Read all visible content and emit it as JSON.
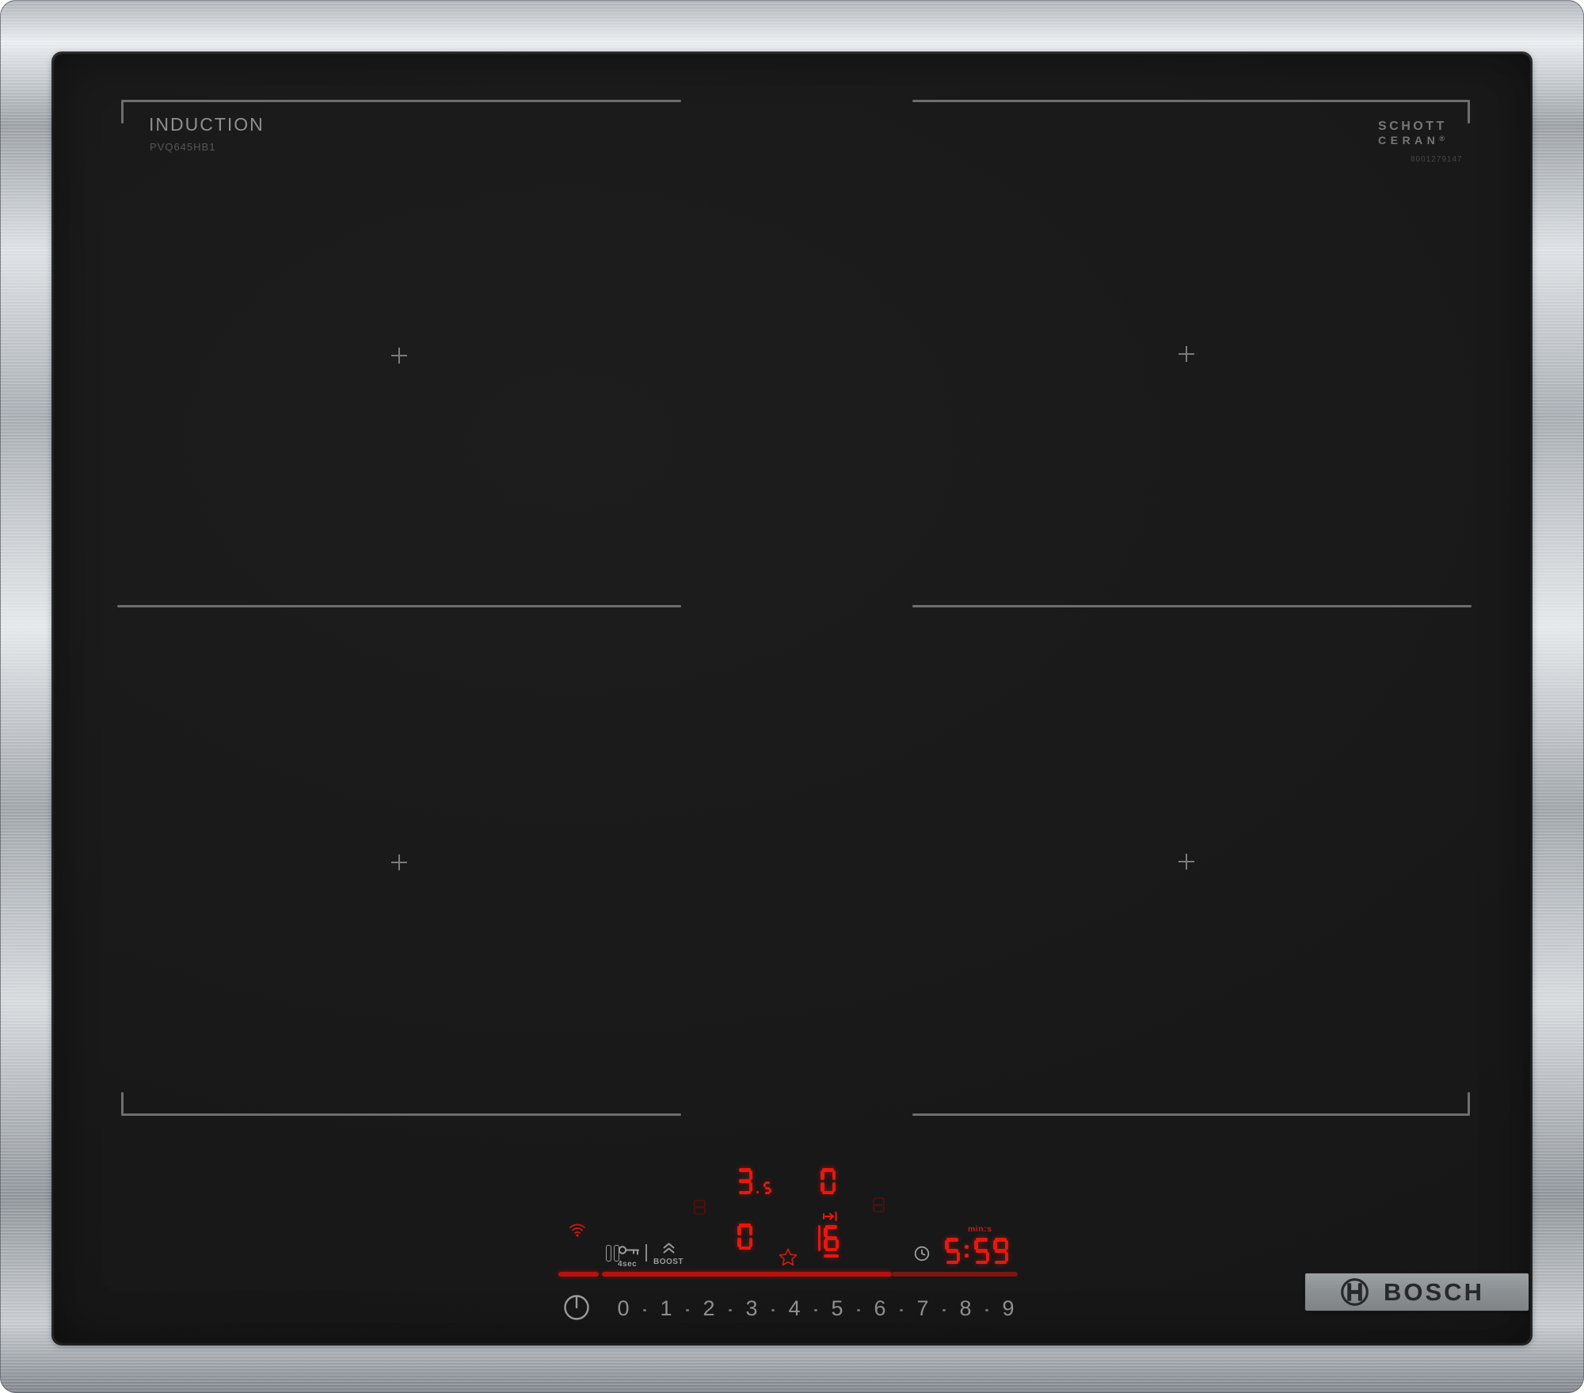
{
  "branding": {
    "type_label": "INDUCTION",
    "model": "PVQ645HB1",
    "glass_brand_line1": "SCHOTT",
    "glass_brand_line2": "CERAN",
    "glass_brand_reg": "®",
    "serial": "8001279147",
    "manufacturer": "BOSCH"
  },
  "zones": {
    "marker_glyph": "+"
  },
  "controls": {
    "lock_duration_label": "4sec",
    "boost_label": "BOOST",
    "timer_unit_label": "min:s",
    "power_level_numbers": [
      "0",
      "1",
      "2",
      "3",
      "4",
      "5",
      "6",
      "7",
      "8",
      "9"
    ],
    "displays": {
      "rear_left": "3.5",
      "rear_right": "0",
      "front_left": "0",
      "front_right": "6",
      "timer": "5:59"
    },
    "slider_level": 6,
    "icons": {
      "wifi": "wifi-icon",
      "pause": "pause-icon",
      "child_lock": "key-lock-icon",
      "boost": "double-chevron-up-icon",
      "move_pan": "arrow-to-bar-icon",
      "favorite": "star-icon",
      "timer": "clock-icon",
      "power": "power-standby-icon",
      "bosch_logo": "bosch-anchor-icon"
    }
  },
  "colors": {
    "display_red": "#e8170e",
    "indicator_red": "#cf1812",
    "dim_red": "#4a110c",
    "slider_red": "#b5120d",
    "slider_dim_red": "#7a1712",
    "icon_gray": "#9c9c9c",
    "marking_gray": "#6e6e6e",
    "text_gray": "#8f8f8f"
  }
}
